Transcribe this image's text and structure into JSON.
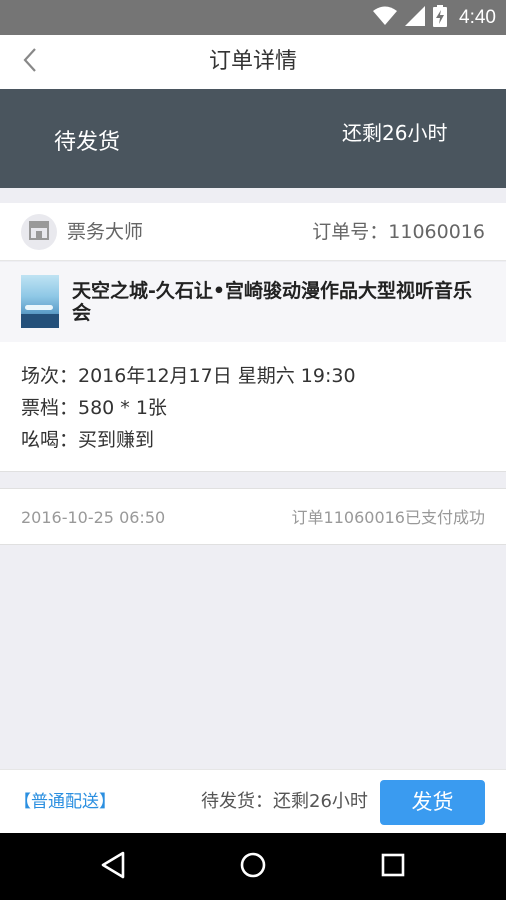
{
  "status_bar": {
    "time": "4:40",
    "icons": [
      "wifi-icon",
      "cell-signal-icon",
      "battery-charging-icon"
    ]
  },
  "app_bar": {
    "title": "订单详情",
    "back_icon": "chevron-left-icon"
  },
  "banner": {
    "status": "待发货",
    "remaining": "还剩26小时"
  },
  "seller": {
    "name": "票务大师",
    "order_number": "订单号：11060016",
    "icon": "store-icon"
  },
  "product": {
    "title": "天空之城-久石让•宫崎骏动漫作品大型视听音乐会"
  },
  "details": [
    "场次：2016年12月17日 星期六 19:30",
    "票档：580 * 1张",
    "吆喝：买到赚到"
  ],
  "log": {
    "time": "2016-10-25 06:50",
    "message": "订单11060016已支付成功"
  },
  "bottom_bar": {
    "shipping_method": "【普通配送】",
    "status": "待发货：还剩26小时",
    "ship_button": "发货"
  },
  "nav_bar": {
    "icons": [
      "back-triangle-icon",
      "home-circle-icon",
      "recents-square-icon"
    ]
  },
  "colors": {
    "banner": "#4a555e",
    "accent": "#3a9bf0",
    "link": "#2b8fe0"
  }
}
